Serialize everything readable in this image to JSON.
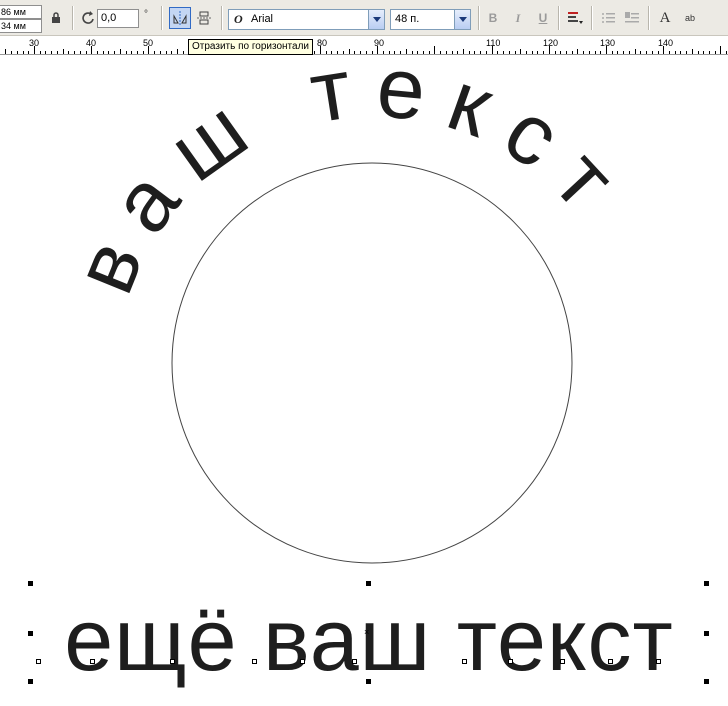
{
  "propbar": {
    "size_w": "86 мм",
    "size_h": "34 мм",
    "angle_value": "0,0",
    "degree_symbol": "°",
    "font_name": "Arial",
    "font_size": "48 п.",
    "bold_label": "B",
    "italic_label": "I",
    "underline_label": "U",
    "text_icon_label": "A",
    "abc_icon_label": "ab"
  },
  "tooltip": {
    "text": "Отразить по горизонтали"
  },
  "ruler": {
    "labels": [
      "30",
      "40",
      "50",
      "80",
      "90",
      "110",
      "120",
      "130",
      "140"
    ]
  },
  "canvas": {
    "arc_text": "ваш текст",
    "bottom_text": "ещё ваш текст"
  },
  "colors": {
    "text": "#1e1e1e",
    "toolbar_bg": "#eceae4",
    "tooltip_bg": "#ffffe1",
    "active_toggle": "#c4d6f3"
  }
}
